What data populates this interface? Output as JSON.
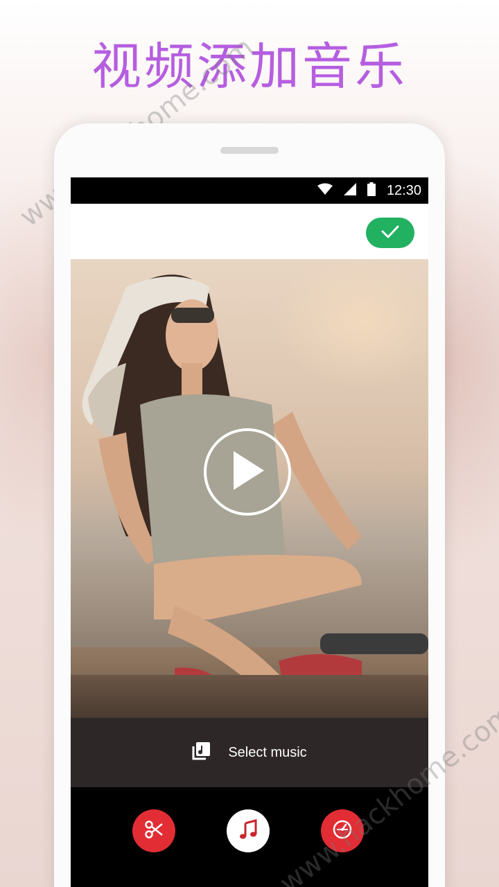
{
  "promo": {
    "title": "视频添加音乐",
    "watermark_top": "www.hackhome.com",
    "watermark_bottom": "www.hackhome.com"
  },
  "status_bar": {
    "time": "12:30",
    "icons": [
      "wifi-icon",
      "cell-signal-icon",
      "battery-icon"
    ]
  },
  "toolbar": {
    "confirm_icon": "checkmark-icon",
    "confirm_color": "#22b061"
  },
  "video": {
    "play_icon": "play-icon"
  },
  "music_bar": {
    "icon": "music-library-icon",
    "label": "Select music"
  },
  "bottom_actions": [
    {
      "icon": "scissors-icon",
      "color": "#e22d35"
    },
    {
      "icon": "music-note-icon",
      "color": "#ffffff"
    },
    {
      "icon": "speedometer-icon",
      "color": "#e22d35"
    }
  ],
  "colors": {
    "title_purple": "#b55ee0",
    "accent_red": "#e22d35",
    "accent_green": "#22b061",
    "music_bar_bg": "#2e2727"
  }
}
